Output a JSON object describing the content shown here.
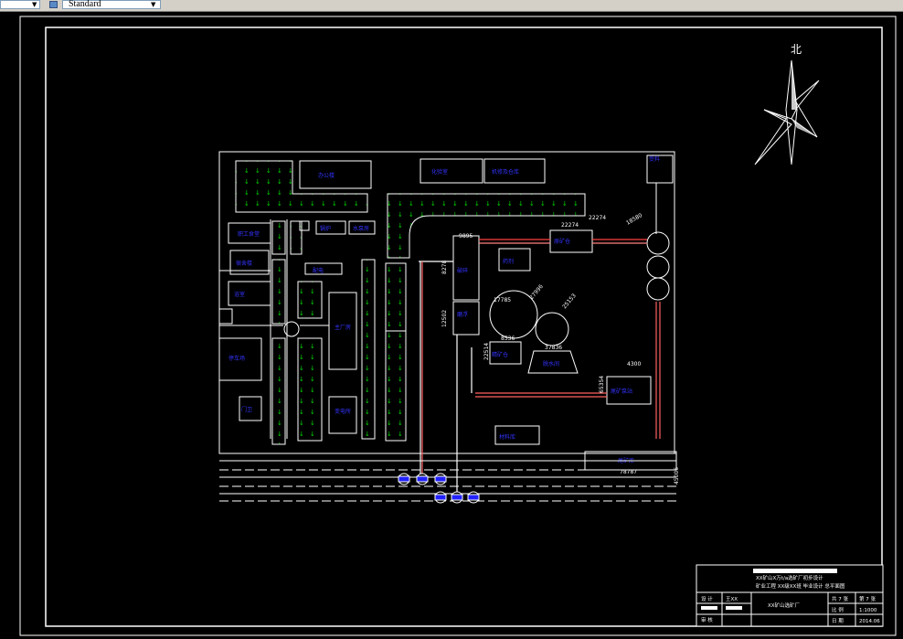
{
  "toolbar": {
    "style_select_value": "Standard",
    "style_icon": "text-style-icon",
    "dropdown_icon": "chevron-down-icon"
  },
  "colors": {
    "background": "#000000",
    "lines": "#ffffff",
    "labels": "#3333ff",
    "trees": "#00dd00",
    "pipes": "#ff6666"
  },
  "compass": {
    "label": "北"
  },
  "dimensions": {
    "pipe_a": "22274",
    "pipe_b": "17785",
    "pipe_c": "8536",
    "pipe_d": "9895",
    "pipe_e": "8278",
    "pipe_f": "18580",
    "pipe_g": "27996",
    "pipe_h": "37836",
    "pipe_i": "25153",
    "pipe_j": "12502",
    "pipe_k": "22514",
    "pipe_l": "4300",
    "pipe_m": "78787",
    "pipe_n": "65354",
    "pipe_o": "45006"
  },
  "title_block": {
    "title_line1": "XX矿山X万t/a选矿厂初步设计",
    "title_line2": "矿业工程 XX级XX班 毕业设计 总平面图",
    "designer_label": "设 计",
    "designer_name": "王XX",
    "checker_label": "审 核",
    "drawing_name": "XX矿山选矿厂",
    "total_sheets": "共 7 张",
    "sheet_no": "第 7 张",
    "scale_label": "比 例",
    "scale_value": "1:1000",
    "date_label": "日 期",
    "date_value": "2014.06"
  }
}
